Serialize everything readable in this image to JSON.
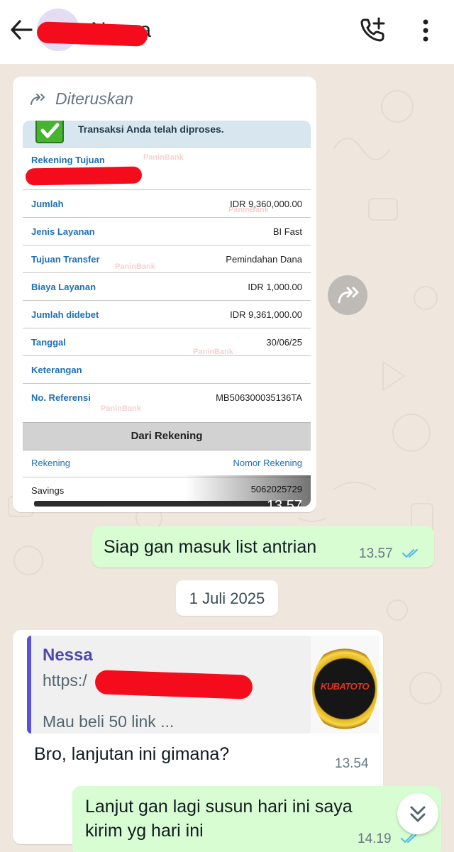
{
  "header": {
    "contact_name": "Nessa",
    "back_icon": "arrow-left-icon",
    "call_icon": "add-call-icon",
    "menu_icon": "more-vert-icon"
  },
  "messages": {
    "forwarded": {
      "label": "Diteruskan",
      "time": "13.57",
      "receipt": {
        "banner": "Transaksi Anda telah diproses.",
        "watermark": "PaninBank",
        "rows": [
          {
            "label": "Rekening Tujuan",
            "value": ""
          },
          {
            "label": "Jumlah",
            "value": "IDR 9,360,000.00"
          },
          {
            "label": "Jenis Layanan",
            "value": "BI Fast"
          },
          {
            "label": "Tujuan Transfer",
            "value": "Pemindahan Dana"
          },
          {
            "label": "Biaya Layanan",
            "value": "IDR 1,000.00"
          },
          {
            "label": "Jumlah didebet",
            "value": "IDR 9,361,000.00"
          },
          {
            "label": "Tanggal",
            "value": "30/06/25"
          },
          {
            "label": "Keterangan",
            "value": ""
          },
          {
            "label": "No. Referensi",
            "value": "MB506300035136TA"
          }
        ],
        "section_title": "Dari Rekening",
        "col_left": "Rekening",
        "col_right": "Nomor Rekening",
        "account_type": "Savings",
        "account_number": "5062025729"
      }
    },
    "reply_1": {
      "text": "Siap gan masuk list antrian",
      "time": "13.57"
    },
    "date_separator": "1 Juli 2025",
    "incoming_2": {
      "quote_name": "Nessa",
      "quote_link": "https:/",
      "quote_text": "Mau beli 50 link ...",
      "thumb_text": "KUBATOTO",
      "text": "Bro, lanjutan ini gimana?",
      "time": "13.54"
    },
    "reply_2": {
      "text_line1": "Lanjut gan lagi susun hari ini saya",
      "text_line2": "kirim yg hari ini",
      "time": "14.19"
    }
  },
  "colors": {
    "header_bg": "#ffffff",
    "chat_bg": "#efe7de",
    "outgoing_bubble": "#d9fdd3",
    "tick_blue": "#53bdeb",
    "redaction": "#f40c1c"
  }
}
